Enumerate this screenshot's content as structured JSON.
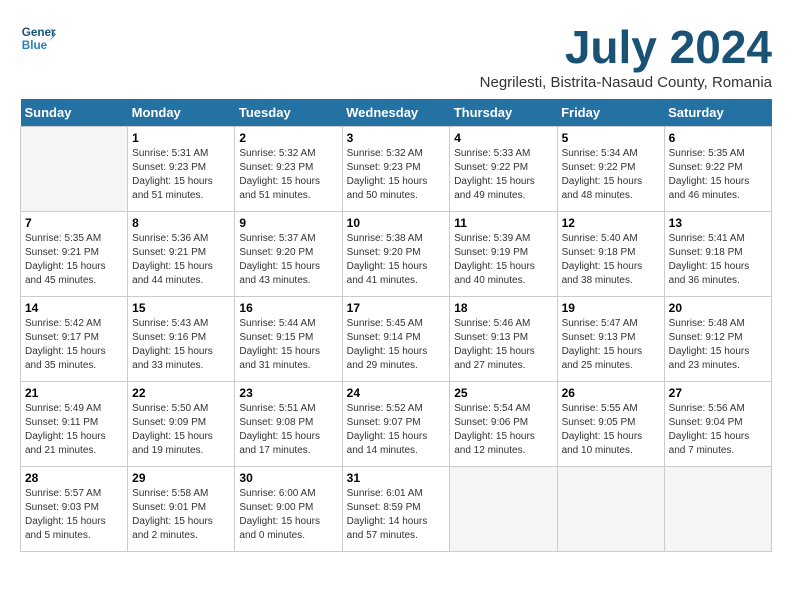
{
  "header": {
    "logo_line1": "General",
    "logo_line2": "Blue",
    "month_year": "July 2024",
    "location": "Negrilesti, Bistrita-Nasaud County, Romania"
  },
  "calendar": {
    "days_of_week": [
      "Sunday",
      "Monday",
      "Tuesday",
      "Wednesday",
      "Thursday",
      "Friday",
      "Saturday"
    ],
    "weeks": [
      [
        {
          "day": "",
          "info": ""
        },
        {
          "day": "1",
          "info": "Sunrise: 5:31 AM\nSunset: 9:23 PM\nDaylight: 15 hours\nand 51 minutes."
        },
        {
          "day": "2",
          "info": "Sunrise: 5:32 AM\nSunset: 9:23 PM\nDaylight: 15 hours\nand 51 minutes."
        },
        {
          "day": "3",
          "info": "Sunrise: 5:32 AM\nSunset: 9:23 PM\nDaylight: 15 hours\nand 50 minutes."
        },
        {
          "day": "4",
          "info": "Sunrise: 5:33 AM\nSunset: 9:22 PM\nDaylight: 15 hours\nand 49 minutes."
        },
        {
          "day": "5",
          "info": "Sunrise: 5:34 AM\nSunset: 9:22 PM\nDaylight: 15 hours\nand 48 minutes."
        },
        {
          "day": "6",
          "info": "Sunrise: 5:35 AM\nSunset: 9:22 PM\nDaylight: 15 hours\nand 46 minutes."
        }
      ],
      [
        {
          "day": "7",
          "info": "Sunrise: 5:35 AM\nSunset: 9:21 PM\nDaylight: 15 hours\nand 45 minutes."
        },
        {
          "day": "8",
          "info": "Sunrise: 5:36 AM\nSunset: 9:21 PM\nDaylight: 15 hours\nand 44 minutes."
        },
        {
          "day": "9",
          "info": "Sunrise: 5:37 AM\nSunset: 9:20 PM\nDaylight: 15 hours\nand 43 minutes."
        },
        {
          "day": "10",
          "info": "Sunrise: 5:38 AM\nSunset: 9:20 PM\nDaylight: 15 hours\nand 41 minutes."
        },
        {
          "day": "11",
          "info": "Sunrise: 5:39 AM\nSunset: 9:19 PM\nDaylight: 15 hours\nand 40 minutes."
        },
        {
          "day": "12",
          "info": "Sunrise: 5:40 AM\nSunset: 9:18 PM\nDaylight: 15 hours\nand 38 minutes."
        },
        {
          "day": "13",
          "info": "Sunrise: 5:41 AM\nSunset: 9:18 PM\nDaylight: 15 hours\nand 36 minutes."
        }
      ],
      [
        {
          "day": "14",
          "info": "Sunrise: 5:42 AM\nSunset: 9:17 PM\nDaylight: 15 hours\nand 35 minutes."
        },
        {
          "day": "15",
          "info": "Sunrise: 5:43 AM\nSunset: 9:16 PM\nDaylight: 15 hours\nand 33 minutes."
        },
        {
          "day": "16",
          "info": "Sunrise: 5:44 AM\nSunset: 9:15 PM\nDaylight: 15 hours\nand 31 minutes."
        },
        {
          "day": "17",
          "info": "Sunrise: 5:45 AM\nSunset: 9:14 PM\nDaylight: 15 hours\nand 29 minutes."
        },
        {
          "day": "18",
          "info": "Sunrise: 5:46 AM\nSunset: 9:13 PM\nDaylight: 15 hours\nand 27 minutes."
        },
        {
          "day": "19",
          "info": "Sunrise: 5:47 AM\nSunset: 9:13 PM\nDaylight: 15 hours\nand 25 minutes."
        },
        {
          "day": "20",
          "info": "Sunrise: 5:48 AM\nSunset: 9:12 PM\nDaylight: 15 hours\nand 23 minutes."
        }
      ],
      [
        {
          "day": "21",
          "info": "Sunrise: 5:49 AM\nSunset: 9:11 PM\nDaylight: 15 hours\nand 21 minutes."
        },
        {
          "day": "22",
          "info": "Sunrise: 5:50 AM\nSunset: 9:09 PM\nDaylight: 15 hours\nand 19 minutes."
        },
        {
          "day": "23",
          "info": "Sunrise: 5:51 AM\nSunset: 9:08 PM\nDaylight: 15 hours\nand 17 minutes."
        },
        {
          "day": "24",
          "info": "Sunrise: 5:52 AM\nSunset: 9:07 PM\nDaylight: 15 hours\nand 14 minutes."
        },
        {
          "day": "25",
          "info": "Sunrise: 5:54 AM\nSunset: 9:06 PM\nDaylight: 15 hours\nand 12 minutes."
        },
        {
          "day": "26",
          "info": "Sunrise: 5:55 AM\nSunset: 9:05 PM\nDaylight: 15 hours\nand 10 minutes."
        },
        {
          "day": "27",
          "info": "Sunrise: 5:56 AM\nSunset: 9:04 PM\nDaylight: 15 hours\nand 7 minutes."
        }
      ],
      [
        {
          "day": "28",
          "info": "Sunrise: 5:57 AM\nSunset: 9:03 PM\nDaylight: 15 hours\nand 5 minutes."
        },
        {
          "day": "29",
          "info": "Sunrise: 5:58 AM\nSunset: 9:01 PM\nDaylight: 15 hours\nand 2 minutes."
        },
        {
          "day": "30",
          "info": "Sunrise: 6:00 AM\nSunset: 9:00 PM\nDaylight: 15 hours\nand 0 minutes."
        },
        {
          "day": "31",
          "info": "Sunrise: 6:01 AM\nSunset: 8:59 PM\nDaylight: 14 hours\nand 57 minutes."
        },
        {
          "day": "",
          "info": ""
        },
        {
          "day": "",
          "info": ""
        },
        {
          "day": "",
          "info": ""
        }
      ]
    ]
  }
}
